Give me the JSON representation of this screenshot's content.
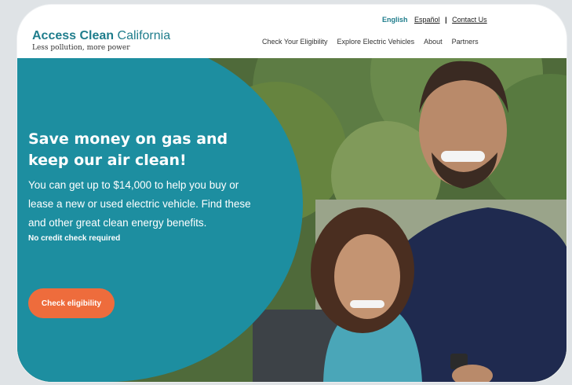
{
  "header": {
    "logo_strong": "Access Clean",
    "logo_light": "California",
    "tagline": "Less pollution, more power",
    "lang_links": [
      {
        "label": "English"
      },
      {
        "label": "Español"
      },
      {
        "label": "|"
      },
      {
        "label": "Contact Us"
      }
    ],
    "nav": [
      {
        "label": "Check Your Eligibility"
      },
      {
        "label": "Explore Electric Vehicles"
      },
      {
        "label": "About"
      },
      {
        "label": "Partners"
      }
    ]
  },
  "hero": {
    "headline_line1": "Save money on gas and",
    "headline_line2": "keep our air clean!",
    "body": "You can get up to $14,000 to help you buy or lease a new or used electric vehicle. Find these and other great clean energy benefits.",
    "note": "No credit check required",
    "cta_label": "Check eligibility",
    "photo_icon": "father-daughter-photo"
  },
  "colors": {
    "brand_teal": "#1f7d8c",
    "hero_blob": "#1d8ea0",
    "cta": "#ee6c3c"
  }
}
